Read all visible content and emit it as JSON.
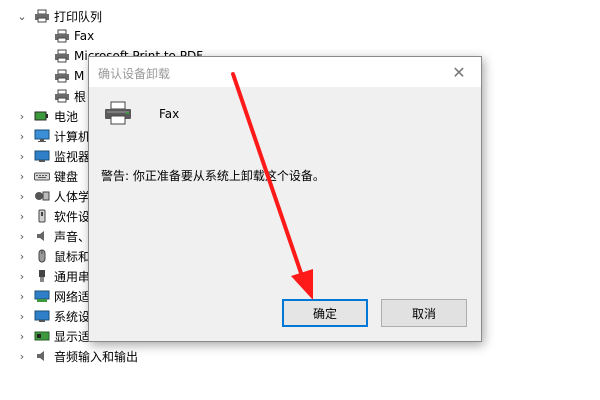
{
  "tree": {
    "cropped_top_label": "",
    "print_queues": {
      "label": "打印队列",
      "children": [
        {
          "label": "Fax"
        },
        {
          "label": "Microsoft Print to PDF"
        },
        {
          "label": "M"
        },
        {
          "label": "根"
        }
      ]
    },
    "categories": [
      {
        "label": "电池",
        "icon": "battery-icon"
      },
      {
        "label": "计算机",
        "icon": "computer-icon"
      },
      {
        "label": "监视器",
        "icon": "monitor-icon"
      },
      {
        "label": "键盘",
        "icon": "keyboard-icon"
      },
      {
        "label": "人体学",
        "icon": "hid-icon"
      },
      {
        "label": "软件设",
        "icon": "software-device-icon"
      },
      {
        "label": "声音、",
        "icon": "speaker-icon"
      },
      {
        "label": "鼠标和",
        "icon": "mouse-icon"
      },
      {
        "label": "通用串",
        "icon": "usb-icon"
      },
      {
        "label": "网络适",
        "icon": "network-adapter-icon"
      },
      {
        "label": "系统设",
        "icon": "system-device-icon"
      },
      {
        "label": "显示适",
        "icon": "display-adapter-icon"
      },
      {
        "label": "音频输入和输出",
        "icon": "audio-io-icon"
      }
    ]
  },
  "dialog": {
    "title": "确认设备卸载",
    "close_glyph": "✕",
    "device_name": "Fax",
    "warning": "警告: 你正准备要从系统上卸载这个设备。",
    "ok_label": "确定",
    "cancel_label": "取消"
  },
  "colors": {
    "annotation_arrow": "#ff1a1a",
    "focus_border": "#0078d7"
  }
}
